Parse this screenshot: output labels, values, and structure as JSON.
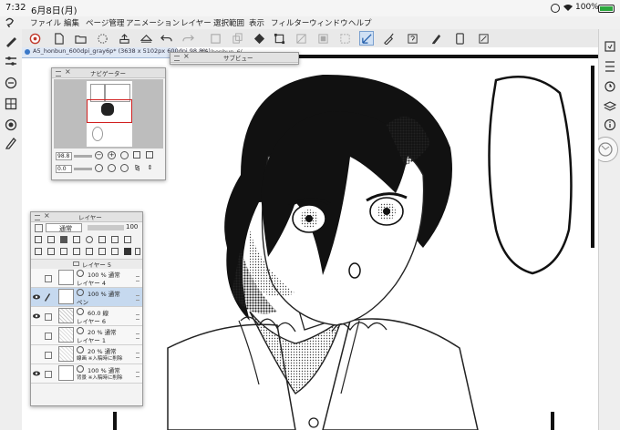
{
  "status": {
    "time": "7:32",
    "date": "6月8日(月)",
    "battery": "100%"
  },
  "menu": [
    "ファイル",
    "編集",
    "ページ管理",
    "アニメーション",
    "レイヤー",
    "選択範囲",
    "表示",
    "フィルター",
    "ウィンドウ",
    "ヘルプ"
  ],
  "doc_tab": {
    "title": "A5_honbun_600dpi_gray6p* (3638 x 5102px 600dpi 98.8%)",
    "second": "A5_honbun_6("
  },
  "navigator": {
    "title": "ナビゲーター",
    "zoom": "98.8",
    "angle": "0.0"
  },
  "subview": {
    "title": "サブビュー"
  },
  "layers": {
    "title": "レイヤー",
    "blend_mode": "通常",
    "opacity": "100",
    "folder_label": "レイヤー 5",
    "rows": [
      {
        "line1": "100 %  通常",
        "line2": "レイヤー 4",
        "selected": false,
        "visible": false
      },
      {
        "line1": "100 %  通常",
        "line2": "ペン",
        "selected": true,
        "visible": true
      },
      {
        "line1": "60.0 線",
        "line2": "レイヤー 6",
        "selected": false,
        "visible": true
      },
      {
        "line1": "20 %  通常",
        "line2": "レイヤー 1",
        "selected": false,
        "visible": false
      },
      {
        "line1": "20 %  通常",
        "line2": "線画  ※入稿時に削除",
        "selected": false,
        "visible": false
      },
      {
        "line1": "100 %  通常",
        "line2": "背景  ※入稿時に削除",
        "selected": false,
        "visible": true
      }
    ]
  },
  "colors": {
    "accent": "#3a78c8",
    "selected_row": "#c6d9ef",
    "nav_frame": "#d11f1f"
  }
}
